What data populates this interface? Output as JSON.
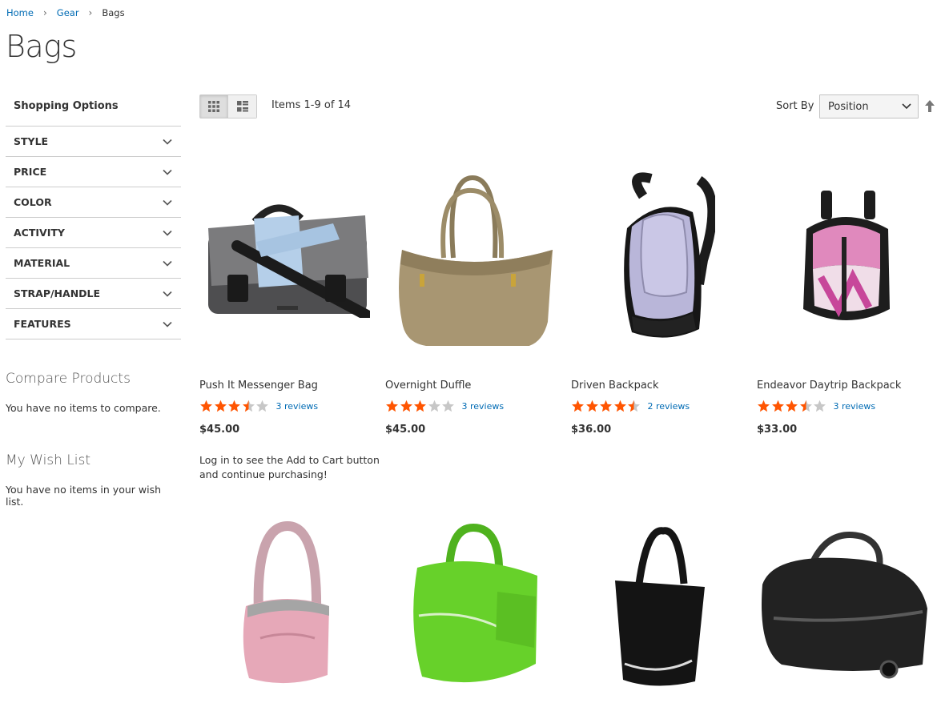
{
  "breadcrumb": {
    "home": "Home",
    "gear": "Gear",
    "current": "Bags"
  },
  "page_title": "Bags",
  "sidebar": {
    "shopping_options": "Shopping Options",
    "filters": [
      "STYLE",
      "PRICE",
      "COLOR",
      "ACTIVITY",
      "MATERIAL",
      "STRAP/HANDLE",
      "FEATURES"
    ],
    "compare_title": "Compare Products",
    "compare_text": "You have no items to compare.",
    "wishlist_title": "My Wish List",
    "wishlist_text": "You have no items in your wish list."
  },
  "toolbar": {
    "amount": "Items 1-9 of 14",
    "sort_label": "Sort By",
    "sort_value": "Position"
  },
  "products": [
    {
      "name": "Push It Messenger Bag",
      "rating": 3.5,
      "reviews": "3 reviews",
      "price": "$45.00"
    },
    {
      "name": "Overnight Duffle",
      "rating": 3,
      "reviews": "3 reviews",
      "price": "$45.00"
    },
    {
      "name": "Driven Backpack",
      "rating": 4.5,
      "reviews": "2 reviews",
      "price": "$36.00"
    },
    {
      "name": "Endeavor Daytrip Backpack",
      "rating": 3.5,
      "reviews": "3 reviews",
      "price": "$33.00"
    }
  ],
  "login_note": "Log in to see the Add to Cart button and continue purchasing!",
  "colors": {
    "link": "#006bb4",
    "star": "#ff5501",
    "star_empty": "#c7c7c7"
  }
}
